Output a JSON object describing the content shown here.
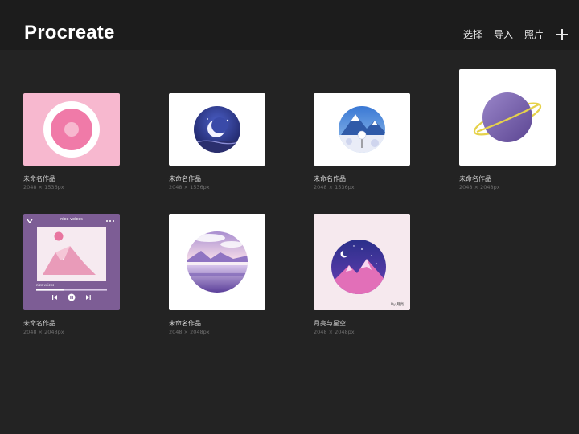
{
  "header": {
    "app_title": "Procreate",
    "actions": {
      "select": "选择",
      "import": "导入",
      "photos": "照片"
    }
  },
  "gallery": [
    {
      "name": "未命名作品",
      "size": "2048 × 1536px",
      "art": "donut-icon"
    },
    {
      "name": "未命名作品",
      "size": "2048 × 1536px",
      "art": "crescent-moon-icon"
    },
    {
      "name": "未命名作品",
      "size": "2048 × 1536px",
      "art": "snowy-mountain-icon"
    },
    {
      "name": "未命名作品",
      "size": "2048 × 2048px",
      "art": "planet-icon"
    },
    {
      "name": "未命名作品",
      "size": "2048 × 2048px",
      "art": "music-player-icon",
      "player": {
        "title": "nice voices",
        "caption": "nice voices"
      }
    },
    {
      "name": "未命名作品",
      "size": "2048 × 2048px",
      "art": "lake-landscape-icon"
    },
    {
      "name": "月亮与星空",
      "size": "2048 × 2048px",
      "art": "moon-stars-mountain-icon",
      "signature": "By 月亮"
    }
  ],
  "colors": {
    "background": "#232323",
    "topbar": "#1c1c1c",
    "donut": "#f7b8cf",
    "player": "#7d5d95"
  }
}
